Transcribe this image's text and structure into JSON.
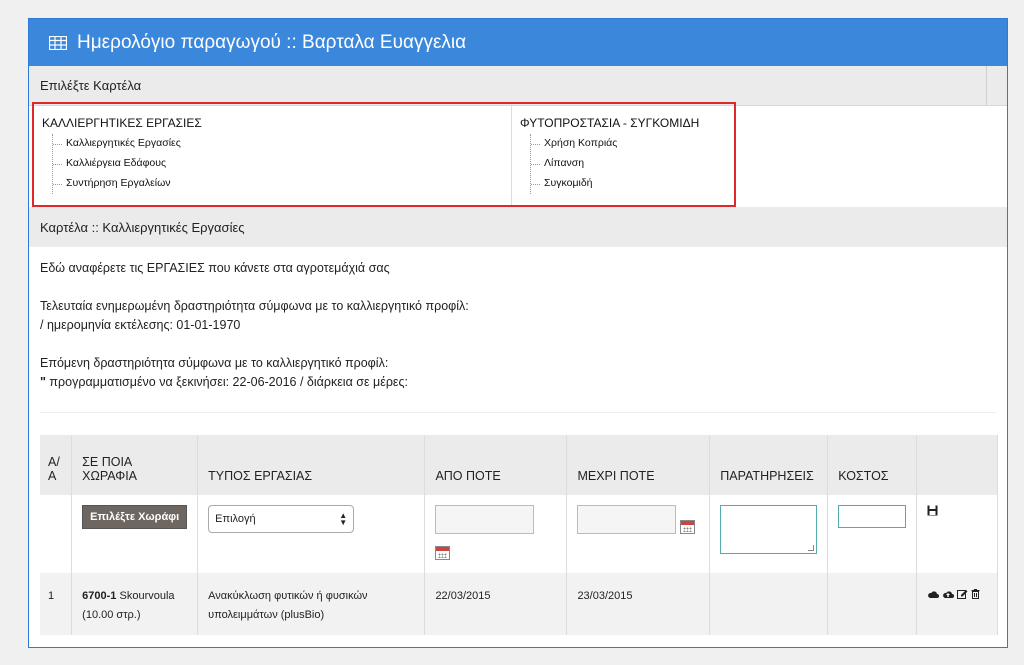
{
  "panel": {
    "title": "Ημερολόγιο παραγωγού :: Βαρταλα Ευαγγελια",
    "icon": "table-icon"
  },
  "select_card": {
    "label": "Επιλέξτε Καρτέλα"
  },
  "tab_groups": [
    {
      "title": "ΚΑΛΛΙΕΡΓΗΤΙΚΕΣ ΕΡΓΑΣΙΕΣ",
      "items": [
        "Καλλιεργητικές Εργασίες",
        "Καλλιέργεια Εδάφους",
        "Συντήρηση Εργαλείων"
      ]
    },
    {
      "title": "ΦΥΤΟΠΡΟΣΤΑΣΙΑ - ΣΥΓΚΟΜΙΔΗ",
      "items": [
        "Χρήση Κοπριάς",
        "Λίπανση",
        "Συγκομιδή"
      ]
    }
  ],
  "card": {
    "title": "Καρτέλα :: Καλλιεργητικές Εργασίες",
    "intro": "Εδώ αναφέρετε τις ΕΡΓΑΣΙΕΣ που κάνετε στα αγροτεμάχιά σας",
    "last_activity_line1": "Τελευταία ενημερωμένη δραστηριότητα σύμφωνα με το καλλιεργητικό προφίλ:",
    "last_activity_line2": "/ ημερομηνία εκτέλεσης: 01-01-1970",
    "next_activity_line1": "Επόμενη δραστηριότητα σύμφωνα με το καλλιεργητικό προφίλ:",
    "next_activity_quote": "\"",
    "next_activity_line2": " προγραμματισμένο να ξεκινήσει: 22-06-2016 / διάρκεια σε μέρες:"
  },
  "table": {
    "headers": {
      "num": "Α/Α",
      "field": "ΣΕ ΠΟΙΑ ΧΩΡΑΦΙΑ",
      "type": "ΤΥΠΟΣ ΕΡΓΑΣΙΑΣ",
      "from": "ΑΠΟ ΠΟΤΕ",
      "to": "ΜΕΧΡΙ ΠΟΤΕ",
      "notes": "ΠΑΡΑΤΗΡΗΣΕΙΣ",
      "cost": "ΚΟΣΤΟΣ"
    },
    "input_row": {
      "field_button": "Επιλέξτε Χωράφι",
      "type_select": "Επιλογή"
    },
    "rows": [
      {
        "num": "1",
        "field_code": "6700-1",
        "field_name": " Skourvoula",
        "field_area": "(10.00 στρ.)",
        "type": "Ανακύκλωση φυτικών ή φυσικών υπολειμμάτων (plusBio)",
        "from": "22/03/2015",
        "to": "23/03/2015",
        "notes": "",
        "cost": ""
      }
    ]
  }
}
